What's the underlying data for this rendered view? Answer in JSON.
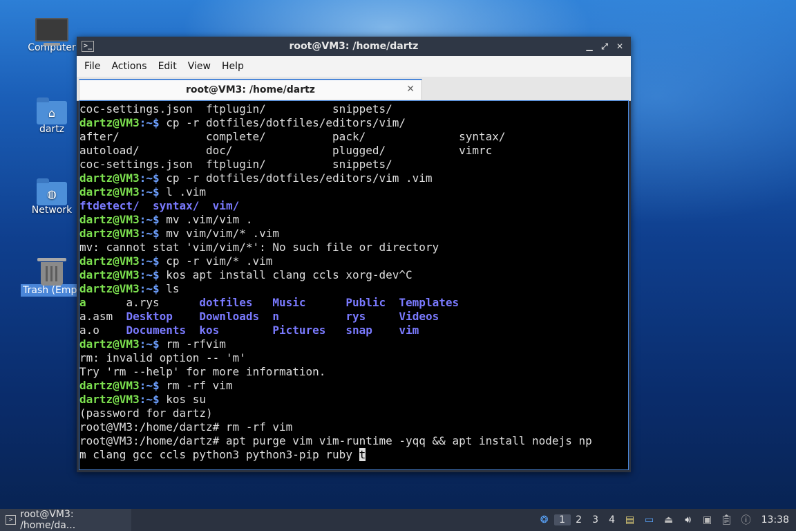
{
  "desktop": {
    "icons": [
      {
        "label": "Computer",
        "icon": "computer-icon"
      },
      {
        "label": "dartz",
        "icon": "home-folder-icon"
      },
      {
        "label": "Network",
        "icon": "network-folder-icon"
      },
      {
        "label": "Trash (Empt",
        "icon": "trash-icon"
      }
    ]
  },
  "window": {
    "title": "root@VM3: /home/dartz",
    "controls": {
      "minimize": "▁",
      "maximize": "⤢",
      "close": "✕"
    },
    "menu": [
      "File",
      "Actions",
      "Edit",
      "View",
      "Help"
    ],
    "tab": {
      "label": "root@VM3: /home/dartz",
      "close": "✕"
    }
  },
  "terminal": {
    "prompt_user": "dartz@VM3",
    "prompt_path": ":~$",
    "lines": [
      {
        "t": "plain",
        "text": "coc-settings.json  ftplugin/          snippets/"
      },
      {
        "t": "cmd",
        "cmd": " cp -r dotfiles/dotfiles/editors/vim/"
      },
      {
        "t": "plain",
        "text": "after/             complete/          pack/              syntax/"
      },
      {
        "t": "plain",
        "text": "autoload/          doc/               plugged/           vimrc"
      },
      {
        "t": "plain",
        "text": "coc-settings.json  ftplugin/          snippets/"
      },
      {
        "t": "cmd",
        "cmd": " cp -r dotfiles/dotfiles/editors/vim .vim"
      },
      {
        "t": "cmd",
        "cmd": " l .vim"
      },
      {
        "t": "ls1",
        "items": [
          "ftdetect/",
          "syntax/",
          "vim/"
        ]
      },
      {
        "t": "cmd",
        "cmd": " mv .vim/vim ."
      },
      {
        "t": "cmd",
        "cmd": " mv vim/vim/* .vim"
      },
      {
        "t": "plain",
        "text": "mv: cannot stat 'vim/vim/*': No such file or directory"
      },
      {
        "t": "cmd",
        "cmd": " cp -r vim/* .vim"
      },
      {
        "t": "cmd",
        "cmd": " kos apt install clang ccls xorg-dev^C"
      },
      {
        "t": "cmd",
        "cmd": " ls"
      },
      {
        "t": "ls",
        "cells": [
          [
            "a",
            "exe"
          ],
          [
            "a.rys",
            "plain"
          ],
          [
            "dotfiles",
            "dir"
          ],
          [
            "Music",
            "dir"
          ],
          [
            "Public",
            "dir"
          ],
          [
            "Templates",
            "dir"
          ]
        ]
      },
      {
        "t": "ls",
        "cells": [
          [
            "a.asm",
            "plain"
          ],
          [
            "Desktop",
            "dir"
          ],
          [
            "Downloads",
            "dir"
          ],
          [
            "n",
            "dir"
          ],
          [
            "rys",
            "dir"
          ],
          [
            "Videos",
            "dir"
          ]
        ]
      },
      {
        "t": "ls",
        "cells": [
          [
            "a.o",
            "plain"
          ],
          [
            "Documents",
            "dir"
          ],
          [
            "kos",
            "dir"
          ],
          [
            "Pictures",
            "dir"
          ],
          [
            "snap",
            "dir"
          ],
          [
            "vim",
            "dir"
          ]
        ]
      },
      {
        "t": "cmd",
        "cmd": " rm -rfvim"
      },
      {
        "t": "plain",
        "text": "rm: invalid option -- 'm'"
      },
      {
        "t": "plain",
        "text": "Try 'rm --help' for more information."
      },
      {
        "t": "cmd",
        "cmd": " rm -rf vim"
      },
      {
        "t": "cmd",
        "cmd": " kos su"
      },
      {
        "t": "plain",
        "text": "(password for dartz)"
      },
      {
        "t": "plain",
        "text": "root@VM3:/home/dartz# rm -rf vim"
      },
      {
        "t": "plain",
        "text": "root@VM3:/home/dartz# apt purge vim vim-runtime -yqq && apt install nodejs np"
      },
      {
        "t": "input",
        "text": "m clang gcc ccls python3 python3-pip ruby ",
        "cursor": "t"
      }
    ]
  },
  "taskbar": {
    "task_label": "root@VM3: /home/da...",
    "workspaces": [
      "1",
      "2",
      "3",
      "4"
    ],
    "active_workspace": 0,
    "clock": "13:38"
  }
}
